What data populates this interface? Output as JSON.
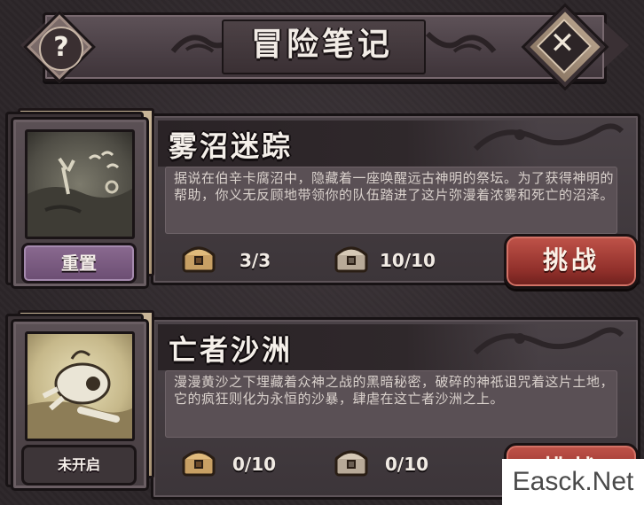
{
  "header": {
    "title": "冒险笔记",
    "help_glyph": "?",
    "close_glyph": "✕"
  },
  "adventures": [
    {
      "title": "雾沼迷踪",
      "description": "据说在伯辛卡腐沼中，隐藏着一座唤醒远古神明的祭坛。为了获得神明的帮助，你义无反顾地带领你的队伍踏进了这片弥漫着浓雾和死亡的沼泽。",
      "chest_small_count": "3/3",
      "chest_large_count": "10/10",
      "action_label": "挑战",
      "book_button_label": "重置",
      "thumbnail_icon": "swamp-scene"
    },
    {
      "title": "亡者沙洲",
      "description": "漫漫黄沙之下埋藏着众神之战的黑暗秘密，破碎的神祇诅咒着这片土地，它的疯狂则化为永恒的沙暴，肆虐在这亡者沙洲之上。",
      "chest_small_count": "0/10",
      "chest_large_count": "0/10",
      "action_label": "挑战",
      "book_button_label": "未开启",
      "thumbnail_icon": "skull-desert-scene"
    }
  ],
  "watermark": "Easck.Net",
  "colors": {
    "challenge_red": "#a83e36",
    "reset_purple": "#7a5c80",
    "panel": "#443c40"
  }
}
